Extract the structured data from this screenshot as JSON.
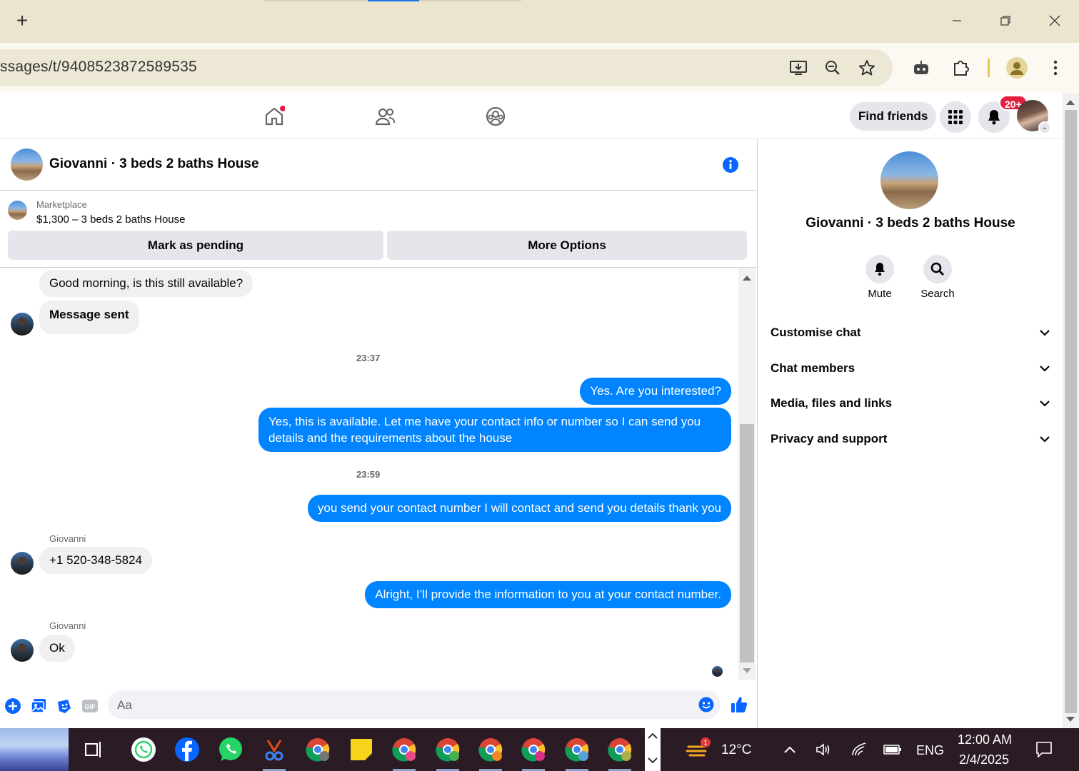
{
  "browser": {
    "url": "ssages/t/9408523872589535",
    "new_tab": "+"
  },
  "fb_header": {
    "find_friends": "Find friends",
    "notif_badge": "20+"
  },
  "chat": {
    "title": "Giovanni · 3 beds 2 baths House",
    "marketplace_label": "Marketplace",
    "listing": "$1,300 – 3 beds 2 baths House",
    "mark_pending": "Mark as pending",
    "more_options": "More Options",
    "messages": [
      {
        "side": "in",
        "text": "Good morning, is this still available?"
      },
      {
        "side": "in",
        "text": "Message sent"
      },
      {
        "type": "time",
        "text": "23:37"
      },
      {
        "side": "out",
        "text": "Yes. Are you interested?"
      },
      {
        "side": "out",
        "text": "Yes, this is available. Let me have your contact info or number so I can send you details and the requirements about the house"
      },
      {
        "type": "time",
        "text": "23:59"
      },
      {
        "side": "out",
        "text": "you send your contact number I will contact  and send you details thank you"
      },
      {
        "side": "in",
        "sender": "Giovanni",
        "text": "+1 520-348-5824"
      },
      {
        "side": "out",
        "text": "Alright, I’ll provide the information to you at your contact number."
      },
      {
        "side": "in",
        "sender": "Giovanni",
        "text": "Ok"
      }
    ],
    "composer_placeholder": "Aa"
  },
  "right_panel": {
    "title": "Giovanni · 3 beds 2 baths House",
    "actions": [
      "Mute",
      "Search"
    ],
    "sections": [
      "Customise chat",
      "Chat members",
      "Media, files and links",
      "Privacy and support"
    ]
  },
  "taskbar": {
    "weather": "12°C",
    "weather_badge": "1",
    "lang": "ENG",
    "time": "12:00 AM",
    "date": "2/4/2025"
  },
  "colors": {
    "accent": "#0084ff",
    "fb_blue": "#0866ff",
    "chrome_bg": "#ebe5cf"
  }
}
